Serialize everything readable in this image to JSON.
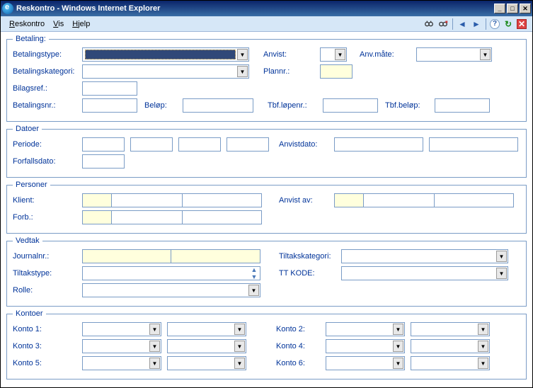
{
  "window": {
    "title": "Reskontro - Windows Internet Explorer"
  },
  "menu": {
    "reskontro": "Reskontro",
    "vis": "Vis",
    "hjelp": "Hjelp"
  },
  "groups": {
    "betaling": "Betaling:",
    "datoer": "Datoer",
    "personer": "Personer",
    "vedtak": "Vedtak",
    "kontoer": "Kontoer"
  },
  "labels": {
    "betalingstype": "Betalingstype:",
    "betalingskategori": "Betalingskategori:",
    "bilagsref": "Bilagsref.:",
    "betalingsnr": "Betalingsnr.:",
    "belop": "Beløp:",
    "anvist": "Anvist:",
    "anvmate": "Anv.måte:",
    "plannr": "Plannr.:",
    "tbflopenr": "Tbf.løpenr.:",
    "tbfbelop": "Tbf.beløp:",
    "periode": "Periode:",
    "forfallsdato": "Forfallsdato:",
    "anvistdato": "Anvistdato:",
    "klient": "Klient:",
    "forb": "Forb.:",
    "anvistav": "Anvist av:",
    "journalnr": "Journalnr.:",
    "tiltakstype": "Tiltakstype:",
    "rolle": "Rolle:",
    "tiltakskategori": "Tiltakskategori:",
    "ttkode": "TT KODE:",
    "konto1": "Konto 1:",
    "konto2": "Konto 2:",
    "konto3": "Konto 3:",
    "konto4": "Konto 4:",
    "konto5": "Konto 5:",
    "konto6": "Konto 6:"
  },
  "values": {
    "betalingstype": "",
    "betalingskategori": "",
    "bilagsref": "",
    "betalingsnr": "",
    "belop": "",
    "anvist": "",
    "anvmate": "",
    "plannr": "",
    "tbflopenr": "",
    "tbfbelop": "",
    "periode1": "",
    "periode2": "",
    "periode3": "",
    "periode4": "",
    "forfallsdato": "",
    "anvistdato1": "",
    "anvistdato2": "",
    "klient1": "",
    "klient2": "",
    "klient3": "",
    "forb1": "",
    "forb2": "",
    "forb3": "",
    "anvistav1": "",
    "anvistav2": "",
    "anvistav3": "",
    "journalnr1": "",
    "journalnr2": "",
    "tiltakstype": "",
    "rolle": "",
    "tiltakskategori": "",
    "ttkode": "",
    "konto1a": "",
    "konto1b": "",
    "konto2a": "",
    "konto2b": "",
    "konto3a": "",
    "konto3b": "",
    "konto4a": "",
    "konto4b": "",
    "konto5a": "",
    "konto5b": "",
    "konto6a": "",
    "konto6b": ""
  }
}
